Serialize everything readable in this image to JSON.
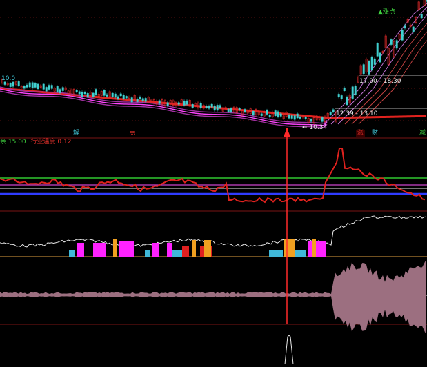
{
  "price_panel": {
    "labels": {
      "buy_point": "▲涨点",
      "price_hi": "17.90 - 18.30",
      "price_lo": "12.39 - 13.10",
      "low_mark": "← 10.34",
      "top_label_left": "10.0"
    },
    "markers": [
      "解",
      "点",
      "涨",
      "财",
      "减"
    ]
  },
  "indicator_header": {
    "name": "亲",
    "value1": "15.00",
    "title": "行业温度",
    "value2": "0.12"
  },
  "colors": {
    "background": "#000000",
    "price_ma_red": "#e0221e",
    "ma_magenta": "#d63cd6",
    "up_candle": "#e02a2a",
    "down_candle": "#40d0d0",
    "vertical_signal": "#ff2a2a",
    "panel_divider": "#7a1414"
  }
}
